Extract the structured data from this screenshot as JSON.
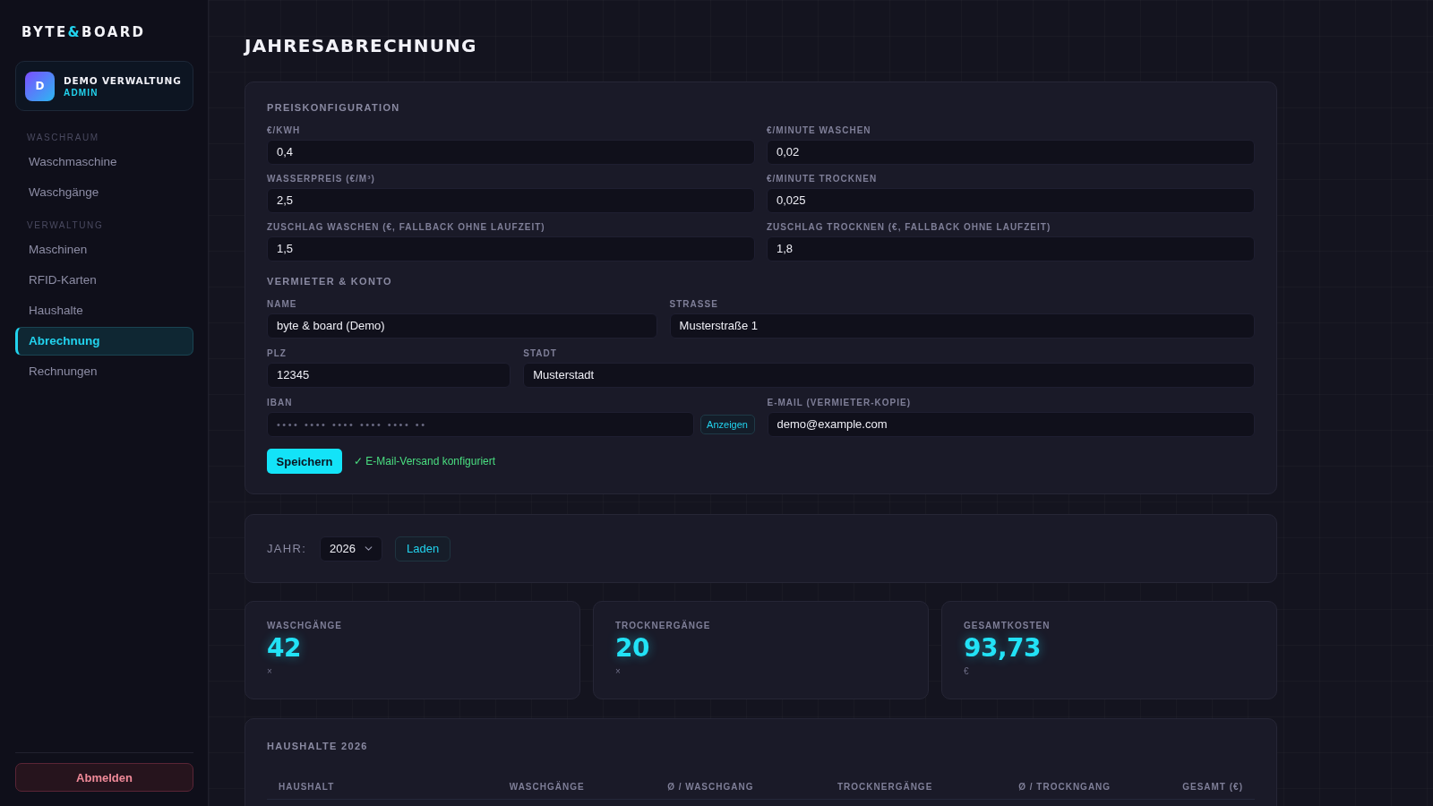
{
  "sidebar": {
    "logo": {
      "before": "BYTE",
      "accent": "&",
      "after": "BOARD"
    },
    "user": {
      "initial": "D",
      "name": "DEMO VERWALTUNG",
      "role": "ADMIN"
    },
    "sections": [
      {
        "title": "WASCHRAUM",
        "items": [
          {
            "label": "Waschmaschine",
            "selected": false
          },
          {
            "label": "Waschgänge",
            "selected": false
          }
        ]
      },
      {
        "title": "VERWALTUNG",
        "items": [
          {
            "label": "Maschinen",
            "selected": false
          },
          {
            "label": "RFID-Karten",
            "selected": false
          },
          {
            "label": "Haushalte",
            "selected": false
          },
          {
            "label": "Abrechnung",
            "selected": true
          },
          {
            "label": "Rechnungen",
            "selected": false
          }
        ]
      }
    ],
    "logout_button": "Abmelden"
  },
  "page_title": "JAHRESABRECHNUNG",
  "settings_card": {
    "price_section": {
      "title": "PREISKONFIGURATION",
      "fields": [
        {
          "label": "€/KWH",
          "value": "0,4"
        },
        {
          "label": "€/MINUTE WASCHEN",
          "value": "0,02"
        },
        {
          "label": "WASSERPREIS (€/M³)",
          "value": "2,5"
        },
        {
          "label": "€/MINUTE TROCKNEN",
          "value": "0,025"
        },
        {
          "label": "ZUSCHLAG WASCHEN (€, FALLBACK OHNE LAUFZEIT)",
          "value": "1,5"
        },
        {
          "label": "ZUSCHLAG TROCKNEN (€, FALLBACK OHNE LAUFZEIT)",
          "value": "1,8"
        }
      ]
    },
    "landlord_section": {
      "title": "VERMIETER & KONTO",
      "rows": [
        {
          "fields": [
            {
              "label": "NAME",
              "value": "byte & board (Demo)",
              "masked": false
            },
            {
              "label": "STRASSE",
              "value": "Musterstraße 1",
              "masked": false
            }
          ]
        },
        {
          "fields": [
            {
              "label": "PLZ",
              "value": "12345",
              "masked": false
            },
            {
              "label": "STADT",
              "value": "Musterstadt",
              "masked": false
            }
          ]
        },
        {
          "fields": [
            {
              "label": "IBAN",
              "value": "•••• •••• •••• •••• •••• ••",
              "masked": true,
              "action": "Anzeigen"
            },
            {
              "label": "E-MAIL (VERMIETER-KOPIE)",
              "value": "demo@example.com",
              "masked": false
            }
          ]
        }
      ]
    },
    "save_button": "Speichern",
    "status": "✓ E-Mail-Versand konfiguriert"
  },
  "year_filter": {
    "label": "JAHR:",
    "value": "2026",
    "button": "Laden"
  },
  "stats": [
    {
      "label": "WASCHGÄNGE",
      "value": "42",
      "unit": "×"
    },
    {
      "label": "TROCKNERGÄNGE",
      "value": "20",
      "unit": "×"
    },
    {
      "label": "GESAMTKOSTEN",
      "value": "93,73",
      "unit": "€"
    }
  ],
  "households_table": {
    "title": "HAUSHALTE 2026",
    "columns": [
      "HAUSHALT",
      "WASCHGÄNGE",
      "Ø / WASCHGANG",
      "TROCKNERGÄNGE",
      "Ø / TROCKNGANG",
      "GESAMT (€)"
    ]
  }
}
